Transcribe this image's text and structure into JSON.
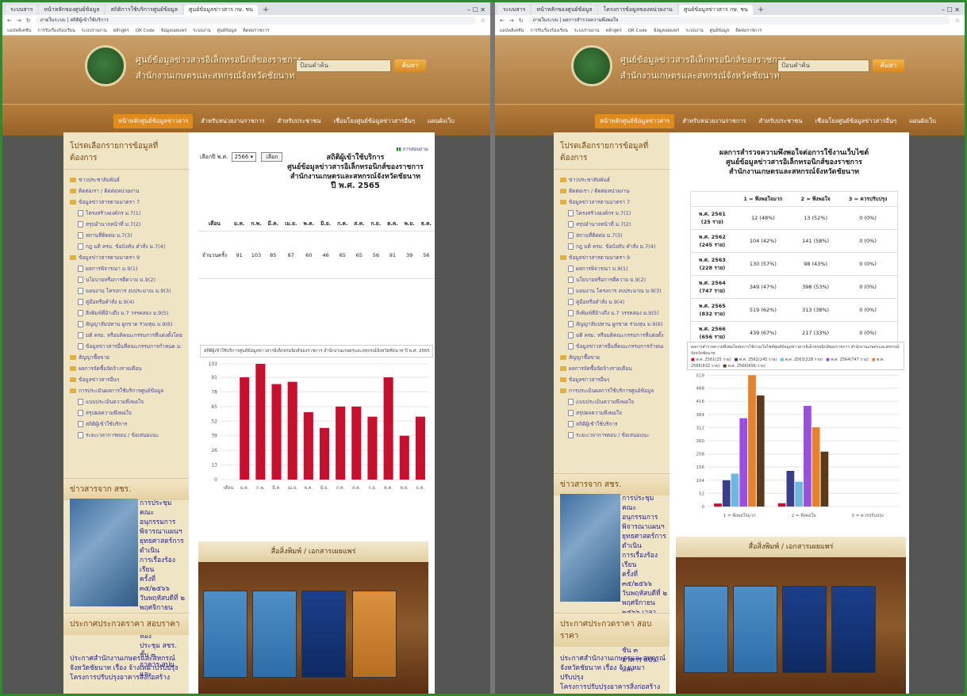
{
  "left": {
    "tabs": [
      "ระบบสาร",
      "หน้าหลักของศูนย์ข้อมูล",
      "สถิติการใช้บริการศูนย์ข้อมูล",
      "ศูนย์ข้อมูลข่าวสาร กษ. ชน"
    ],
    "url": "ภายในระบบ | สถิติผู้เข้าใช้บริการ",
    "bookmarks": [
      "แอปพลิเคชัน",
      "การรับเรื่องร้องเรียน",
      "ระบบรายงาน",
      "หลักสูตร",
      "QR Code",
      "ข้อมูลเผยแพร่",
      "ระบบงาน",
      "ศูนย์ข้อมูล",
      "ติดต่อราชการ"
    ],
    "header": {
      "line1": "ศูนย์ข้อมูลข่าวสารอิเล็กทรอนิกส์ของราชการ",
      "line2": "สำนักงานเกษตรและสหกรณ์จังหวัดชัยนาท",
      "search_placeholder": "ป้อนคำค้น",
      "search_btn": "ค้นหา"
    },
    "nav": [
      "หน้าหลักศูนย์ข้อมูลข่าวสาร",
      "สำหรับหน่วยงานราชการ",
      "สำหรับประชาชน",
      "เชื่อมโยงศูนย์ข้อมูลข่าวสารอื่นๆ",
      "แผนผังเว็บ"
    ],
    "sidebar_title": "โปรดเลือกรายการข้อมูลที่ต้องการ",
    "sidebar_items": [
      "ข่าวประชาสัมพันธ์",
      "ติดต่อเรา / ติดต่อหน่วยงาน",
      "ข้อมูลข่าวสารตามมาตรา 7",
      "โครงสร้างองค์กร ม.7(1)",
      "สรุปอำนาจหน้าที่ ม.7(2)",
      "สถานที่ติดต่อ ม.7(3)",
      "กฎ มติ ครม. ข้อบังคับ คำสั่ง ม.7(4)",
      "ข้อมูลข่าวสารตามมาตรา 9",
      "ผลการพิจารณา ม.9(1)",
      "นโยบายหรือการตีความ ม.9(2)",
      "แผนงาน โครงการ งบประมาณ ม.9(3)",
      "คู่มือหรือคำสั่ง ม.9(4)",
      "สิ่งพิมพ์ที่อ้างถึง ม.7 วรรคสอง ม.9(5)",
      "สัญญาสัมปทาน ผูกขาด ร่วมทุน ม.9(6)",
      "มติ ครม. หรือมติคณะกรรมการที่แต่งตั้งโดยกฎหมาย ม.9(7)",
      "ข้อมูลข่าวสารอื่นที่คณะกรรมการกำหนด ม.9(8)",
      "สัญญาซื้อขาย",
      "ผลการจัดซื้อจัดจ้างรายเดือน",
      "ข้อมูลข่าวสารอื่นๆ",
      "การประเมินผลการใช้บริการศูนย์ข้อมูล",
      "แบบประเมินความพึงพอใจ",
      "สรุปผลความพึงพอใจ",
      "สถิติผู้เข้าใช้บริการ",
      "ระยะเวลาการตอบ / ข้อเสนอแนะ"
    ],
    "news_title": "ข่าวสารจาก สชร.",
    "news_text": [
      "การประชุม",
      "คณะอนุกรรมการ",
      "พิจารณาแผนฯ",
      "ยุทธศาสตร์การดำเนิน",
      "การเรื่องร้องเรียน",
      "ครั้งที่ ๓๕/๒๕๖๖",
      "วันพฤหัสบดีที่ ๒",
      "พฤศจิกายน",
      "๒๕๖๖ เวลา",
      "๑๓.๐๐ น. ณ ห้อง",
      "ประชุม สชร. ชั้น ๓",
      "อาคาร สปน. และ"
    ],
    "procure_title": "ประกาศประกวดราคา สอบราคา",
    "procure_text": [
      "ประกาศสำนักงานเกษตรและสหกรณ์",
      "จังหวัดชัยนาท เรื่อง จ้างเหมาปรับปรุง",
      "โครงการปรับปรุงอาคารสิ่งก่อสร้าง"
    ],
    "year_label": "เลือกปี พ.ศ.",
    "year_value": "2566",
    "select_btn": "เลือก",
    "link_report": "การสอบถาม",
    "stat_title": [
      "สถิติผู้เข้าใช้บริการ",
      "ศูนย์ข้อมูลข่าวสารอิเล็กทรอนิกส์ของราชการ",
      "สำนักงานเกษตรและสหกรณ์จังหวัดชัยนาท",
      "ปี พ.ศ. 2565"
    ],
    "table_head_label": "เดือน",
    "row_label": "จำนวนครั้ง",
    "months": [
      "ม.ค.",
      "ก.พ.",
      "มี.ค.",
      "เม.ย.",
      "พ.ค.",
      "มิ.ย.",
      "ก.ค.",
      "ส.ค.",
      "ก.ย.",
      "ต.ค.",
      "พ.ย.",
      "ธ.ค."
    ],
    "counts": [
      91,
      103,
      85,
      87,
      60,
      46,
      65,
      65,
      56,
      91,
      39,
      56
    ],
    "chart_caption": "สถิติผู้เข้าใช้บริการศูนย์ข้อมูลข่าวสารอิเล็กทรอนิกส์ของราชการ สำนักงานเกษตรและสหกรณ์จังหวัดชัยนาท ปี พ.ศ. 2565",
    "books_title": "สื่อสิ่งพิมพ์ / เอกสารเผยแพร่"
  },
  "right": {
    "tabs": [
      "ระบบสาร",
      "หน้าหลักของศูนย์ข้อมูล",
      "โครงการข้อมูลของหน่วยงาน",
      "ศูนย์ข้อมูลข่าวสาร กษ. ชน"
    ],
    "url": "ภายในระบบ | ผลการสำรวจความพึงพอใจ",
    "bookmarks": [
      "แอปพลิเคชัน",
      "การรับเรื่องร้องเรียน",
      "ระบบรายงาน",
      "หลักสูตร",
      "QR Code",
      "ข้อมูลเผยแพร่",
      "ระบบงาน",
      "ศูนย์ข้อมูล",
      "ติดต่อราชการ"
    ],
    "survey_title": [
      "ผลการสำรวจความพึงพอใจต่อการใช้งานเว็บไซต์",
      "ศูนย์ข้อมูลข่าวสารอิเล็กทรอนิกส์ของราชการ",
      "สำนักงานเกษตรและสหกรณ์จังหวัดชัยนาท"
    ],
    "survey_cols": [
      "1 = พึงพอใจมาก",
      "2 = พึงพอใจ",
      "3 = ควรปรับปรุง"
    ],
    "survey_rows": [
      {
        "year": "พ.ศ. 2561",
        "n": "(25 ราย)",
        "v": [
          "12 (48%)",
          "13 (52%)",
          "0 (0%)"
        ]
      },
      {
        "year": "พ.ศ. 2562",
        "n": "(245 ราย)",
        "v": [
          "104 (42%)",
          "141 (58%)",
          "0 (0%)"
        ]
      },
      {
        "year": "พ.ศ. 2563",
        "n": "(228 ราย)",
        "v": [
          "130 (57%)",
          "98 (43%)",
          "0 (0%)"
        ]
      },
      {
        "year": "พ.ศ. 2564",
        "n": "(747 ราย)",
        "v": [
          "349 (47%)",
          "398 (53%)",
          "0 (0%)"
        ]
      },
      {
        "year": "พ.ศ. 2565",
        "n": "(832 ราย)",
        "v": [
          "519 (62%)",
          "313 (38%)",
          "0 (0%)"
        ]
      },
      {
        "year": "พ.ศ. 2566",
        "n": "(656 ราย)",
        "v": [
          "439 (67%)",
          "217 (33%)",
          "0 (0%)"
        ]
      }
    ],
    "chart_caption": "ผลการสำรวจความพึงพอใจต่อการใช้งานเว็บไซต์ศูนย์ข้อมูลข่าวสารอิเล็กทรอนิกส์ของราชการ สำนักงานเกษตรและสหกรณ์จังหวัดชัยนาท",
    "legend": [
      "พ.ศ. 2561(25 ราย)",
      "พ.ศ. 2562(245 ราย)",
      "พ.ศ. 2563(228 ราย)",
      "พ.ศ. 2564(747 ราย)",
      "พ.ศ. 2565(832 ราย)",
      "พ.ศ. 2566(656 ราย)"
    ],
    "series_colors": [
      "#c8102e",
      "#3c3c8a",
      "#6fb7e0",
      "#9a4fe0",
      "#e8822a",
      "#5a3a1a"
    ]
  },
  "chart_data": [
    {
      "type": "bar",
      "categories": [
        "ม.ค.",
        "ก.พ.",
        "มี.ค.",
        "เม.ย.",
        "พ.ค.",
        "มิ.ย.",
        "ก.ค.",
        "ส.ค.",
        "ก.ย.",
        "ต.ค.",
        "พ.ย.",
        "ธ.ค."
      ],
      "values": [
        91,
        103,
        85,
        87,
        60,
        46,
        65,
        65,
        56,
        91,
        39,
        56
      ],
      "ylim": [
        0,
        103
      ],
      "yticks": [
        0,
        13,
        26,
        39,
        52,
        65,
        78,
        91,
        103
      ],
      "x_first_label": "เดือน",
      "color": "#c8102e"
    },
    {
      "type": "bar",
      "categories": [
        "1 = พึงพอใจมาก",
        "2 = พึงพอใจ",
        "3 = ควรปรับปรุง"
      ],
      "series": [
        {
          "name": "พ.ศ. 2561(25 ราย)",
          "values": [
            12,
            13,
            0
          ]
        },
        {
          "name": "พ.ศ. 2562(245 ราย)",
          "values": [
            104,
            141,
            0
          ]
        },
        {
          "name": "พ.ศ. 2563(228 ราย)",
          "values": [
            130,
            98,
            0
          ]
        },
        {
          "name": "พ.ศ. 2564(747 ราย)",
          "values": [
            349,
            398,
            0
          ]
        },
        {
          "name": "พ.ศ. 2565(832 ราย)",
          "values": [
            519,
            313,
            0
          ]
        },
        {
          "name": "พ.ศ. 2566(656 ราย)",
          "values": [
            439,
            217,
            0
          ]
        }
      ],
      "ylim": [
        0,
        520
      ],
      "yticks": [
        0,
        52,
        104,
        156,
        208,
        260,
        312,
        364,
        416,
        468,
        519
      ]
    }
  ]
}
